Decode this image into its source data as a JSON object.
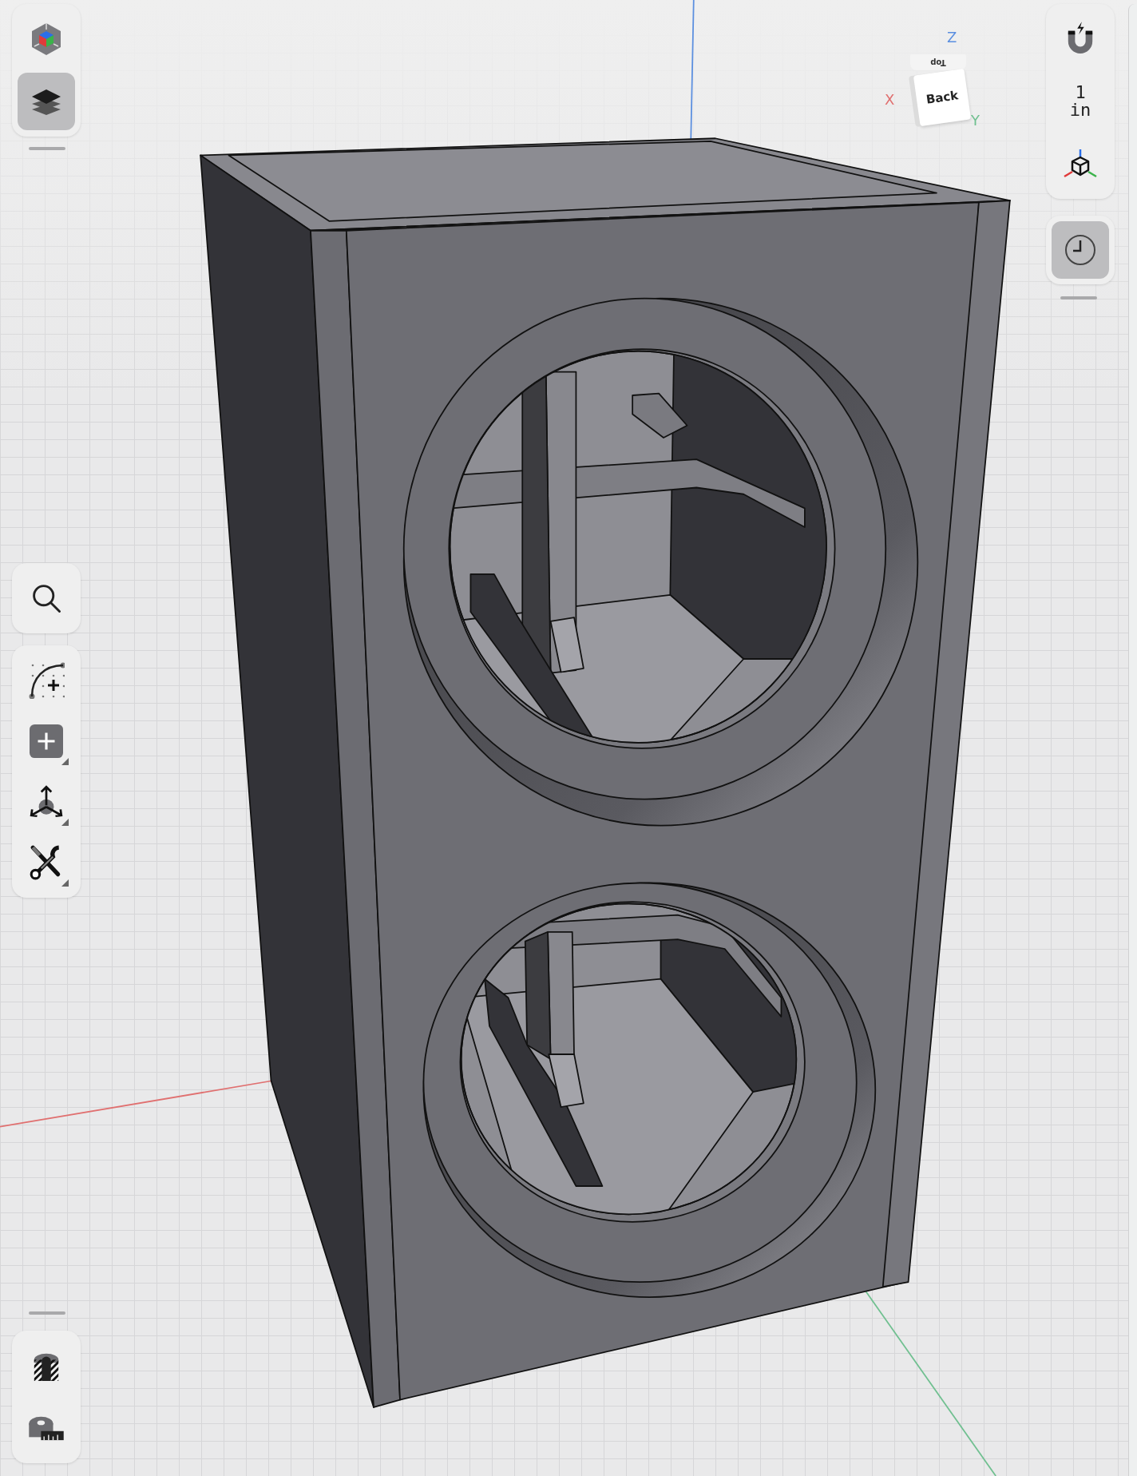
{
  "left_toolbar": {
    "buttons": [
      {
        "kind": "app-logo",
        "selected": false
      },
      {
        "kind": "layers",
        "selected": true
      }
    ]
  },
  "search_button": {
    "kind": "search"
  },
  "tool_palette": {
    "tools": [
      {
        "kind": "sketch",
        "submenu": false
      },
      {
        "kind": "add",
        "submenu": true
      },
      {
        "kind": "transform",
        "submenu": true
      },
      {
        "kind": "tools",
        "submenu": true
      }
    ]
  },
  "inspect_palette": {
    "tools": [
      {
        "kind": "section"
      },
      {
        "kind": "measure"
      }
    ]
  },
  "right_toolbar": {
    "items": [
      {
        "kind": "snap"
      },
      {
        "kind": "units",
        "value": "1",
        "unit": "in"
      },
      {
        "kind": "axes"
      }
    ]
  },
  "history_button": {
    "selected": true
  },
  "view_cube": {
    "front_face": "Back",
    "top_face": "Top",
    "axes": [
      {
        "label": "Z",
        "color": "#5b8fe0"
      },
      {
        "label": "X",
        "color": "#e07070"
      },
      {
        "label": "Y",
        "color": "#70c090"
      }
    ]
  }
}
